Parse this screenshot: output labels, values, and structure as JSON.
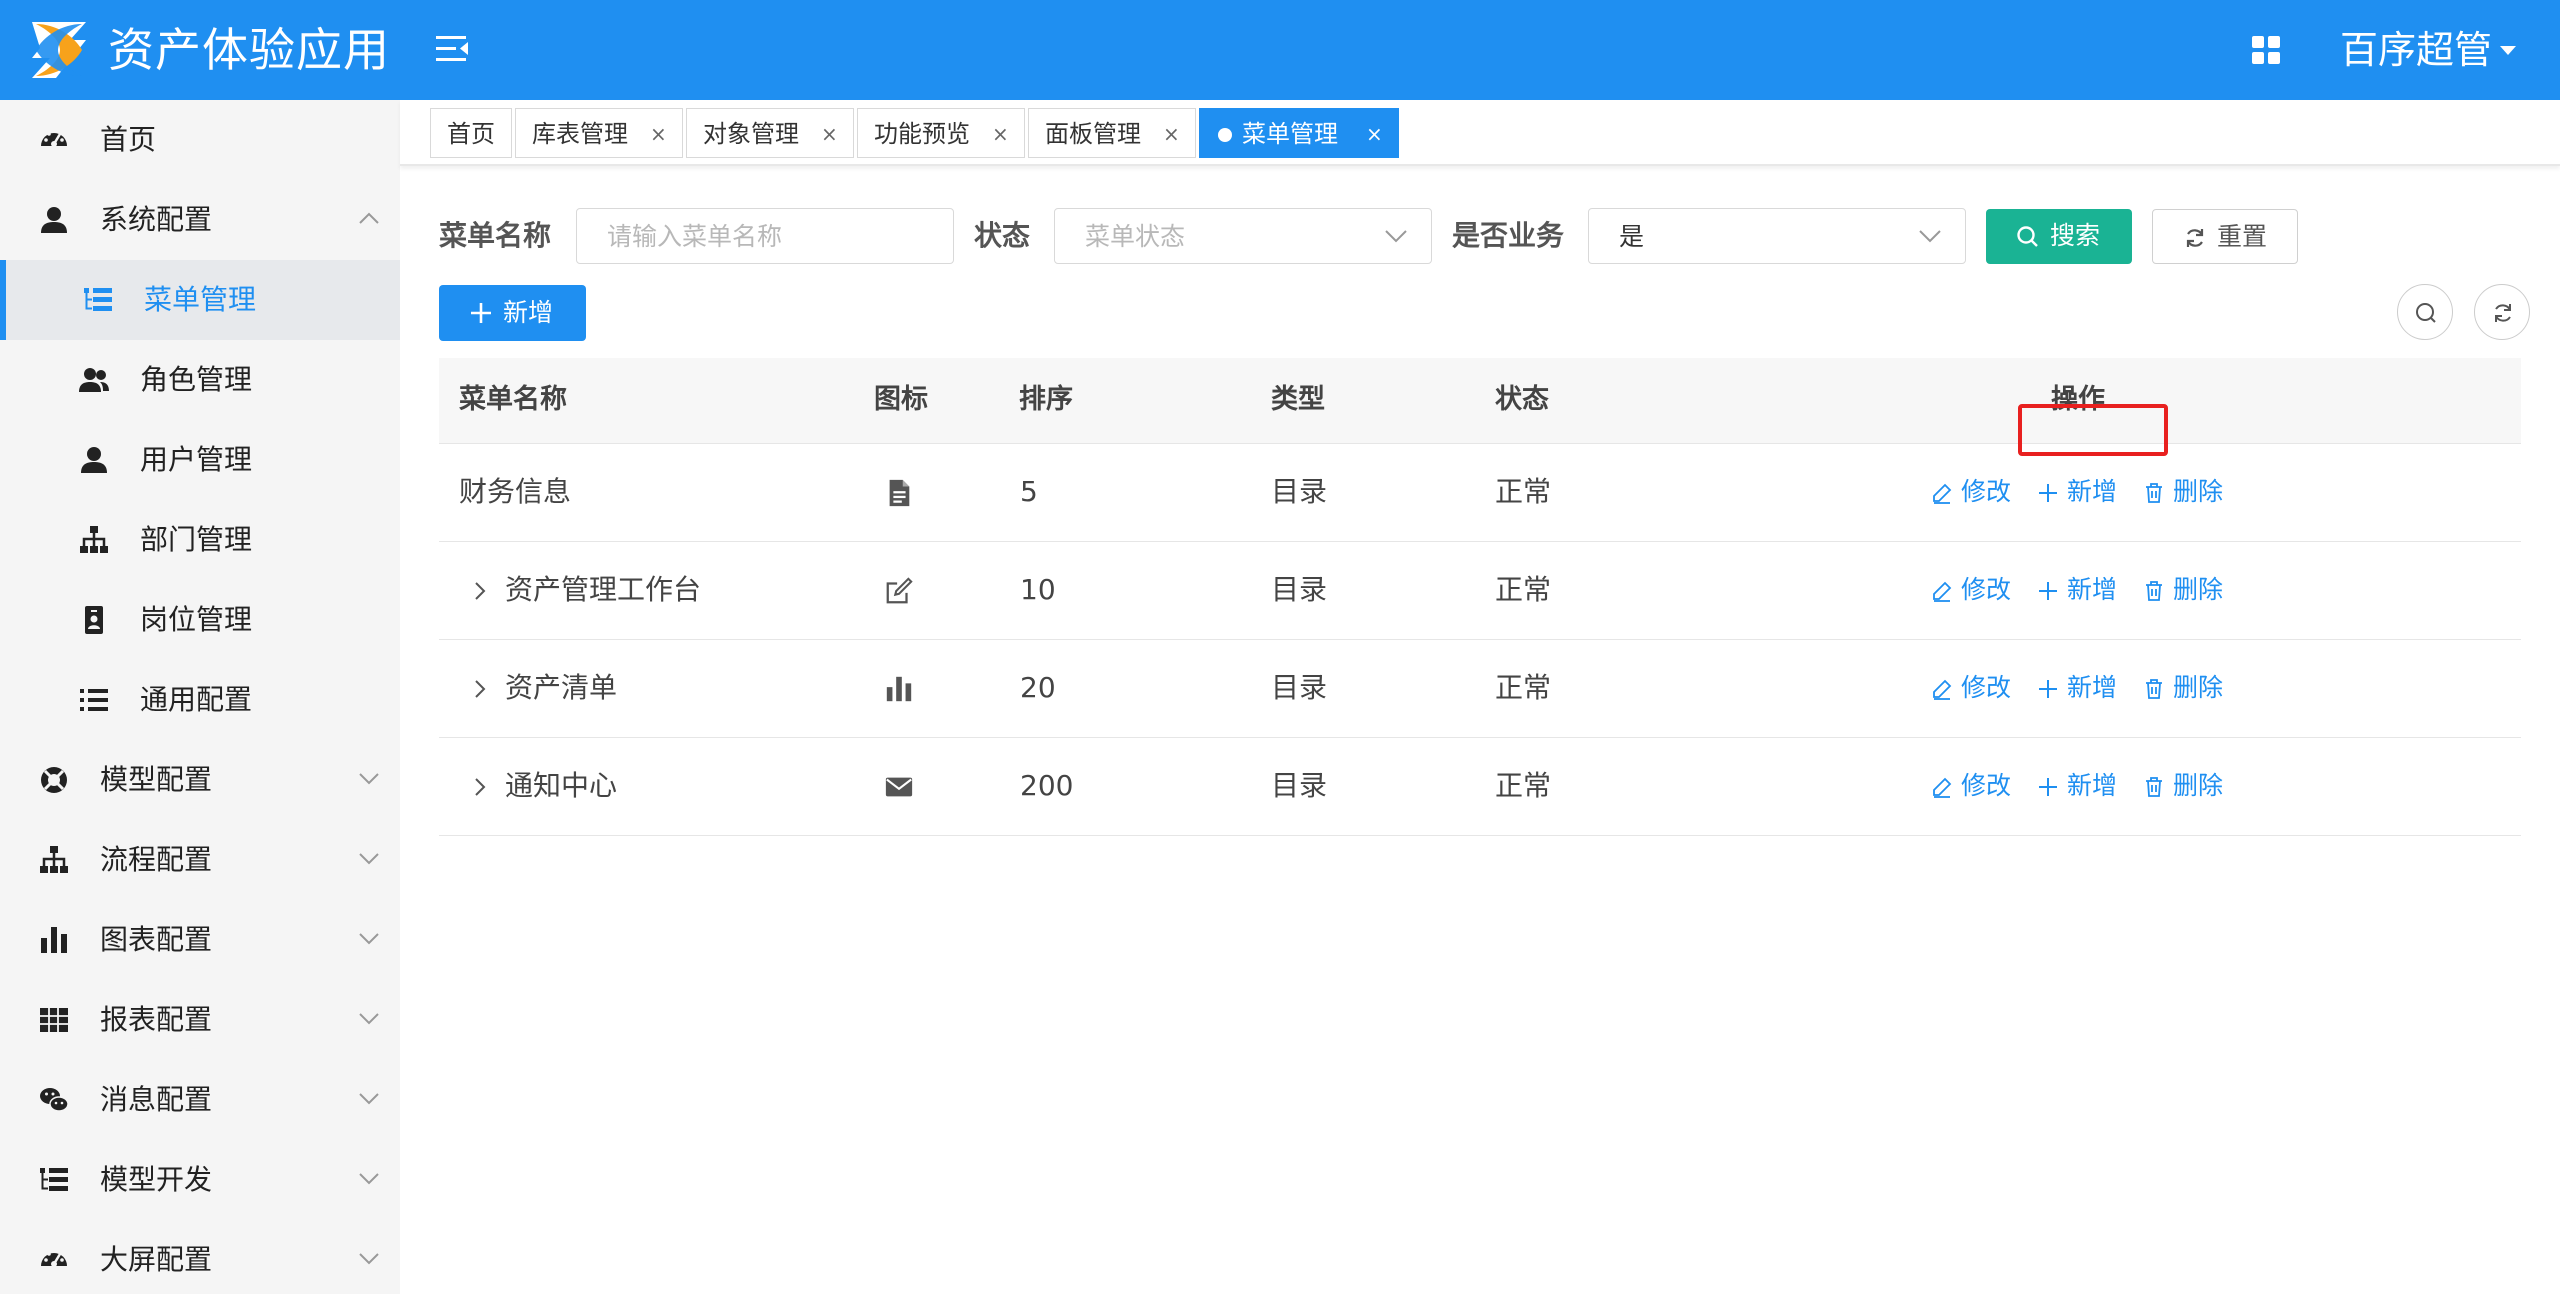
{
  "app": {
    "title": "资产体验应用",
    "user": "百序超管"
  },
  "sidebar": {
    "items": [
      {
        "label": "首页",
        "icon": "dashboard-icon",
        "level": 1
      },
      {
        "label": "系统配置",
        "icon": "user-icon",
        "level": 1,
        "expanded": true
      },
      {
        "label": "菜单管理",
        "icon": "tree-table-icon",
        "level": 2,
        "active": true
      },
      {
        "label": "角色管理",
        "icon": "users-icon",
        "level": 2
      },
      {
        "label": "用户管理",
        "icon": "user-icon",
        "level": 2
      },
      {
        "label": "部门管理",
        "icon": "sitemap-icon",
        "level": 2
      },
      {
        "label": "岗位管理",
        "icon": "id-badge-icon",
        "level": 2
      },
      {
        "label": "通用配置",
        "icon": "list-icon",
        "level": 2
      },
      {
        "label": "模型配置",
        "icon": "life-ring-icon",
        "level": 1
      },
      {
        "label": "流程配置",
        "icon": "sitemap-icon",
        "level": 1
      },
      {
        "label": "图表配置",
        "icon": "bar-chart-icon",
        "level": 1
      },
      {
        "label": "报表配置",
        "icon": "table-grid-icon",
        "level": 1
      },
      {
        "label": "消息配置",
        "icon": "wechat-icon",
        "level": 1
      },
      {
        "label": "模型开发",
        "icon": "tree-table-icon",
        "level": 1
      },
      {
        "label": "大屏配置",
        "icon": "dashboard-icon",
        "level": 1
      }
    ]
  },
  "tabs": [
    {
      "label": "首页",
      "closable": false
    },
    {
      "label": "库表管理",
      "closable": true
    },
    {
      "label": "对象管理",
      "closable": true
    },
    {
      "label": "功能预览",
      "closable": true
    },
    {
      "label": "面板管理",
      "closable": true
    },
    {
      "label": "菜单管理",
      "closable": true,
      "active": true
    }
  ],
  "tab_close_glyph": "×",
  "search": {
    "name_label": "菜单名称",
    "name_placeholder": "请输入菜单名称",
    "status_label": "状态",
    "status_placeholder": "菜单状态",
    "business_label": "是否业务",
    "business_value": "是",
    "search_button": "搜索",
    "reset_button": "重置"
  },
  "toolbar": {
    "add_button": "新增"
  },
  "table": {
    "columns": [
      "菜单名称",
      "图标",
      "排序",
      "类型",
      "状态",
      "操作"
    ],
    "rows": [
      {
        "name": "财务信息",
        "icon": "file-text-icon",
        "order": "5",
        "type": "目录",
        "status": "正常",
        "expandable": false
      },
      {
        "name": "资产管理工作台",
        "icon": "edit-icon",
        "order": "10",
        "type": "目录",
        "status": "正常",
        "expandable": true
      },
      {
        "name": "资产清单",
        "icon": "bar-chart-icon",
        "order": "20",
        "type": "目录",
        "status": "正常",
        "expandable": true
      },
      {
        "name": "通知中心",
        "icon": "envelope-icon",
        "order": "200",
        "type": "目录",
        "status": "正常",
        "expandable": true
      }
    ],
    "actions": {
      "edit": "修改",
      "add": "新增",
      "delete": "删除"
    }
  },
  "colors": {
    "primary": "#1f8ff1",
    "success": "#1ab394",
    "highlight": "#e8201f",
    "sidebar_bg": "#f5f5f5"
  }
}
